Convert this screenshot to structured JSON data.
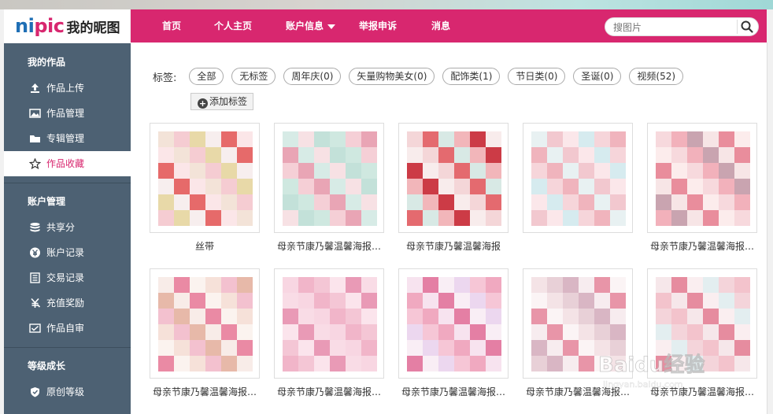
{
  "logo": {
    "brand_en_a": "ni",
    "brand_en_b": "pic",
    "brand_cn": "我的昵图"
  },
  "nav": {
    "items": [
      {
        "label": "首页"
      },
      {
        "label": "个人主页"
      },
      {
        "label": "账户信息"
      },
      {
        "label": "举报申诉"
      },
      {
        "label": "消息"
      }
    ],
    "search_placeholder": "搜图片"
  },
  "sidebar": {
    "sections": [
      {
        "title": "我的作品",
        "items": [
          "作品上传",
          "作品管理",
          "专辑管理",
          "作品收藏"
        ]
      },
      {
        "title": "账户管理",
        "items": [
          "共享分",
          "账户记录",
          "交易记录",
          "充值奖励",
          "作品自审"
        ]
      },
      {
        "title": "等级成长",
        "items": [
          "原创等级"
        ]
      }
    ],
    "active_item": "作品收藏"
  },
  "tags": {
    "label": "标签:",
    "items": [
      "全部",
      "无标签",
      "周年庆(0)",
      "矢量购物美女(0)",
      "配饰类(1)",
      "节日类(0)",
      "圣诞(0)",
      "视频(52)"
    ],
    "add_label": "添加标签"
  },
  "gallery": {
    "items": [
      {
        "caption": "丝带",
        "palette": [
          "#f3e3d8",
          "#f5ccd2",
          "#e8d9a8",
          "#f7eeee",
          "#e66a6a",
          "#fbe6e8"
        ]
      },
      {
        "caption": "母亲节康乃馨温馨海报…",
        "palette": [
          "#cfe8e0",
          "#f5cfd6",
          "#e9a5b5",
          "#d7ebe6",
          "#f7e1e4",
          "#c3e1d9"
        ]
      },
      {
        "caption": "母亲节康乃馨温馨海报",
        "palette": [
          "#f4d6d8",
          "#e46a6f",
          "#d8e9e5",
          "#f2b6ba",
          "#cc3b46",
          "#f8ecec"
        ]
      },
      {
        "caption": "",
        "palette": [
          "#d6ebef",
          "#f6d5da",
          "#f0b4bd",
          "#e8f1f2",
          "#f2c8cf",
          "#fbe7ea"
        ]
      },
      {
        "caption": "母亲节康乃馨温馨海报…",
        "palette": [
          "#f7d9dd",
          "#f2b1bb",
          "#c9a4b0",
          "#f7e5e6",
          "#e98d9c",
          "#fcecec"
        ]
      },
      {
        "caption": "母亲节康乃馨温馨海报…",
        "palette": [
          "#f6e1d9",
          "#f3c1cf",
          "#e7b9a9",
          "#f8ece8",
          "#ea8aa4",
          "#fbf3ef"
        ]
      },
      {
        "caption": "母亲节康乃馨温馨海报…",
        "palette": [
          "#f8d6e2",
          "#f1b5c9",
          "#f4c6d5",
          "#fbe4ec",
          "#e99ab6",
          "#f9dce6"
        ]
      },
      {
        "caption": "母亲节康乃馨温馨海报…",
        "palette": [
          "#ecd7ef",
          "#f6c6d6",
          "#f0a9c0",
          "#f7e3ef",
          "#e47fa4",
          "#f9eef5"
        ]
      },
      {
        "caption": "母亲节康乃馨温馨海报…",
        "palette": [
          "#f4e3e6",
          "#e8d0d7",
          "#d9b6c4",
          "#f7ecef",
          "#e895a8",
          "#fbf4f5"
        ]
      },
      {
        "caption": "母亲节康乃馨温馨海报…",
        "palette": [
          "#e3eef0",
          "#f4d4da",
          "#f3c3cc",
          "#f6e7ea",
          "#e68c9f",
          "#faeef0"
        ]
      }
    ]
  },
  "watermark": {
    "text": "Baidu经验",
    "sub": "jingyan.baidu.com"
  },
  "colors": {
    "nav_bg": "#d8276f",
    "sidebar_bg": "#4d6173",
    "active_text": "#d8276f",
    "logo_blue": "#1f6fb5"
  },
  "icons": [
    "upload-icon",
    "image-icon",
    "folder-icon",
    "star-icon",
    "database-icon",
    "yen-icon",
    "ledger-icon",
    "reward-icon",
    "review-icon",
    "shield-icon",
    "search-icon",
    "plus-icon",
    "caret-down-icon"
  ]
}
